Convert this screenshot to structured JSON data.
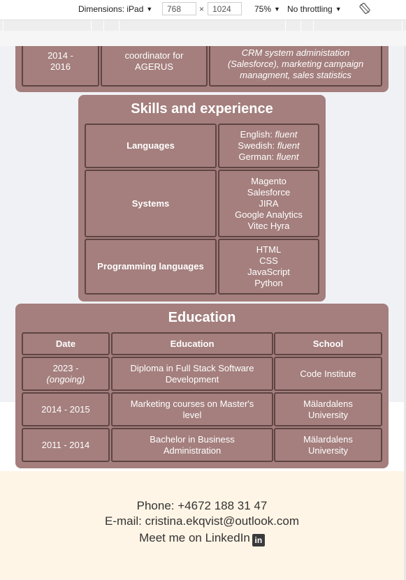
{
  "devtools": {
    "dimensions_label": "Dimensions: iPad",
    "width": "768",
    "times": "×",
    "height": "1024",
    "zoom": "75%",
    "throttling": "No throttling",
    "rotate_icon": "rotate-icon"
  },
  "experience_partial": {
    "date": "2014 -\n2016",
    "role": "coordinator for AGERUS",
    "duties": "CRM system administation (Salesforce), marketing campaign managment, sales statistics"
  },
  "skills": {
    "title": "Skills and experience",
    "rows": [
      {
        "label": "Languages",
        "values": [
          {
            "text": "English: ",
            "em": "fluent"
          },
          {
            "text": "Swedish: ",
            "em": "fluent"
          },
          {
            "text": "German: ",
            "em": "fluent"
          }
        ]
      },
      {
        "label": "Systems",
        "values": [
          "Magento",
          "Salesforce",
          "JIRA",
          "Google Analytics",
          "Vitec Hyra"
        ]
      },
      {
        "label": "Programming languages",
        "values": [
          "HTML",
          "CSS",
          "JavaScript",
          "Python"
        ]
      }
    ]
  },
  "education": {
    "title": "Education",
    "headers": [
      "Date",
      "Education",
      "School"
    ],
    "rows": [
      {
        "date": "2023 -",
        "date_note": "(ongoing)",
        "education": "Diploma in Full Stack Software Development",
        "school": "Code Institute"
      },
      {
        "date": "2014 - 2015",
        "education": "Marketing courses on Master's level",
        "school": "Mälardalens University"
      },
      {
        "date": "2011 - 2014",
        "education": "Bachelor in Business Administration",
        "school": "Mälardalens University"
      }
    ]
  },
  "footer": {
    "phone": "Phone: +4672 188 31 47",
    "email": "E-mail: cristina.ekqvist@outlook.com",
    "linkedin": "Meet me on LinkedIn",
    "linkedin_icon": "in"
  }
}
